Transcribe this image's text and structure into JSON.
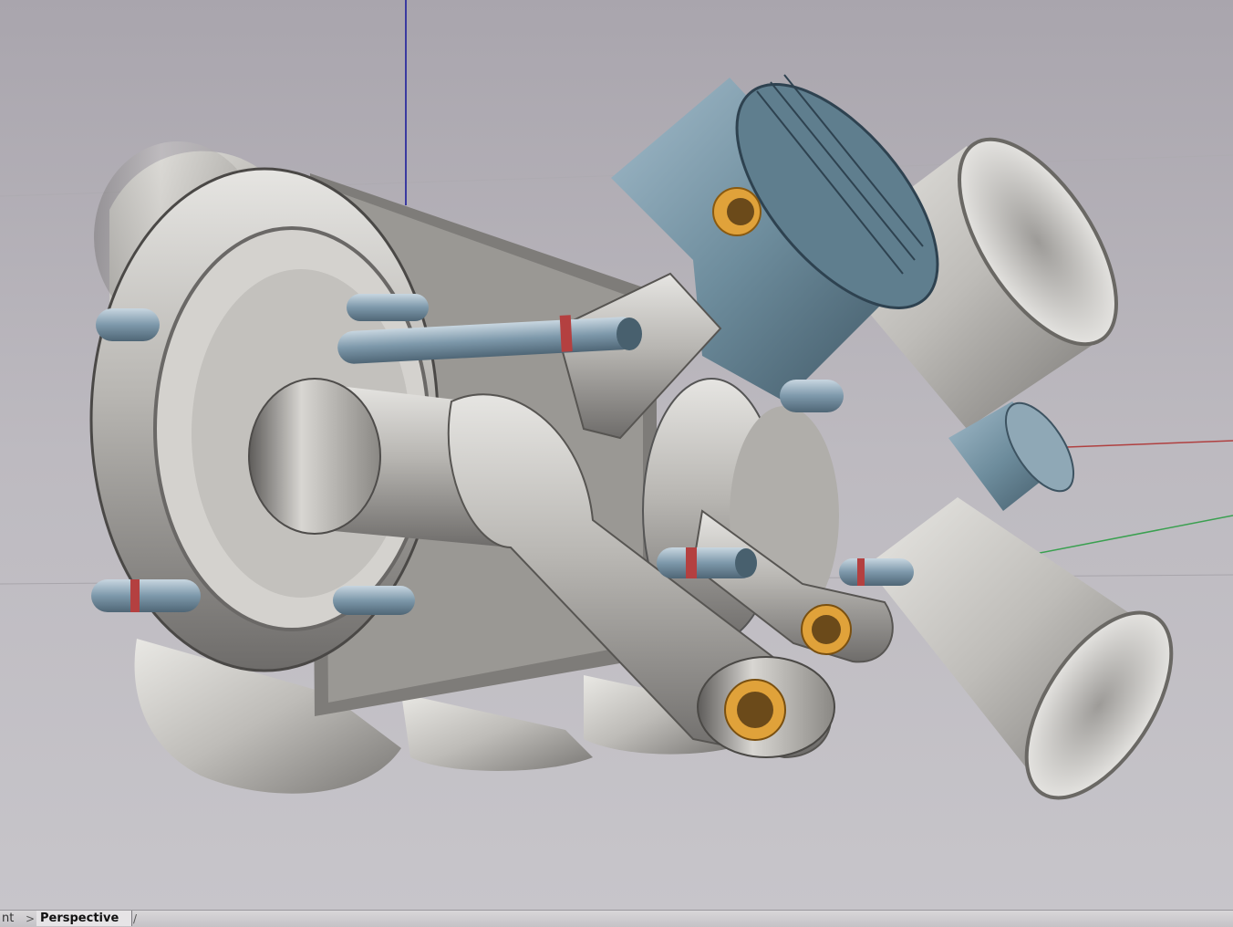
{
  "viewport": {
    "name": "Perspective",
    "background": "#b9b6bb",
    "model_colors": {
      "steel": "#c7c5c3",
      "piston": "#6a8a9a",
      "bushing": "#e0a23a",
      "axis_z": "#3a3aa0",
      "axis_x": "#b04040",
      "axis_y": "#3aa050"
    }
  },
  "tabs": {
    "partial_label": "nt",
    "separator": ">",
    "active_label": "Perspective",
    "trailing_separator": "/"
  }
}
